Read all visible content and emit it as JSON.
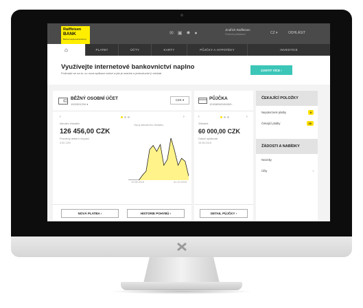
{
  "bank": {
    "logo_line1": "Raiffeisen",
    "logo_line2": "BANK",
    "logo_line3": "Banka inspirovaná klienty"
  },
  "header": {
    "user_name": "Jindřich Raiffeisen",
    "user_sub": "Poslední přihlášení",
    "language": "CZ ▾",
    "logout": "ODHLÁSIT"
  },
  "nav": {
    "items": [
      "⌂",
      "PLATBY",
      "ÚČTY",
      "KARTY",
      "PŮJČKY A HYPOTÉKY",
      "INVESTICE"
    ]
  },
  "banner": {
    "title": "Využívejte internetové bankovnictví naplno",
    "subtitle": "Podívejte se na to, co nová aplikace nabízí a jak je snadné a jednoduché ji ovládat",
    "button": "ZJISTIT VÍCE ›"
  },
  "account": {
    "title": "BĚŽNÝ OSOBNÍ ÚČET",
    "number": "1002001234 ▾",
    "currency": "CZK ▾",
    "balance_label": "Aktuální zůstatek",
    "balance": "126 456,00 CZK",
    "available_label": "Povolený debet k čerpání",
    "available": "0,00 CZK",
    "chart_label": "Vývoj aktuálního zůstatku",
    "date_from": "12.08.2015",
    "date_to": "31.12.2015",
    "btn_payment": "NOVÁ PLATBA  ›",
    "btn_history": "HISTORIE POHYBŮ  ›"
  },
  "loan": {
    "title": "PŮJČKA",
    "number": "123/0805/24545/3...",
    "balance_label": "Zůstatek",
    "balance": "60 000,00 CZK",
    "date_label": "Datum splatnosti",
    "date": "15.08.2015",
    "btn_detail": "DETAIL PŮJČKY  ›"
  },
  "side": {
    "waiting_title": "ČEKAJÍCÍ POLOŽKY",
    "waiting": [
      {
        "label": "Nepotvrzené platby",
        "count": "9"
      },
      {
        "label": "Čekající platby",
        "count": "20"
      }
    ],
    "requests_title": "ŽÁDOSTI A NABÍDKY",
    "requests": [
      {
        "label": "Novinky",
        "arrow": ""
      },
      {
        "label": "Účty",
        "arrow": "›"
      }
    ]
  },
  "colors": {
    "brand_yellow": "#ffee00",
    "teal": "#3cc6b8",
    "dark": "#333333"
  },
  "chart_data": {
    "type": "area",
    "values": [
      0,
      0,
      0,
      0,
      10,
      18,
      62,
      70,
      58,
      72,
      30,
      42,
      85,
      60,
      30,
      44,
      38,
      8
    ]
  }
}
